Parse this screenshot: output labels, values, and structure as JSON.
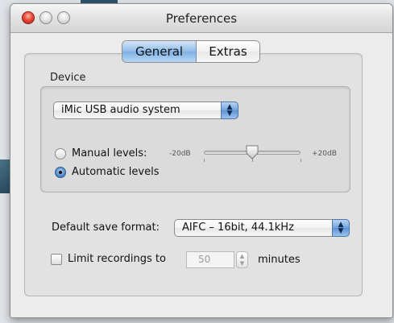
{
  "window": {
    "title": "Preferences"
  },
  "tabs": [
    {
      "label": "General",
      "selected": true
    },
    {
      "label": "Extras",
      "selected": false
    }
  ],
  "device_group": {
    "label": "Device",
    "device_popup": {
      "value": "iMic USB audio system",
      "icon": "popup-arrows-icon"
    },
    "manual_levels": {
      "label": "Manual levels:",
      "selected": false
    },
    "automatic_levels": {
      "label": "Automatic levels",
      "selected": true
    },
    "level_slider": {
      "min_label": "-20dB",
      "max_label": "+20dB",
      "level": 0.5
    }
  },
  "save_format": {
    "label": "Default save format:",
    "value": "AIFC – 16bit, 44.1kHz"
  },
  "limit_recordings": {
    "label": "Limit recordings to",
    "checked": false,
    "value": "50",
    "unit_label": "minutes"
  },
  "colors": {
    "selected_tab": "#8fbbe8",
    "accent_blue": "#5d93d4",
    "close_button": "#e8493a"
  }
}
